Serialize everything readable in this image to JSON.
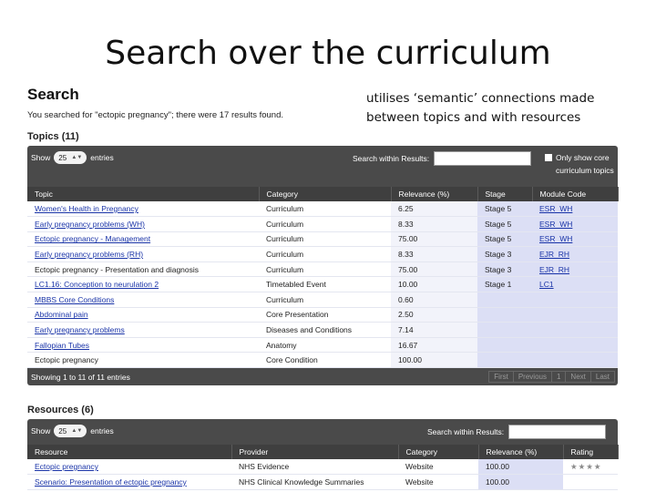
{
  "slide": {
    "title": "Search over the curriculum",
    "caption": "utilises ‘semantic’ connections made between topics and with resources"
  },
  "search": {
    "heading": "Search",
    "summary": "You searched for \"ectopic pregnancy\"; there were 17 results found."
  },
  "topics": {
    "heading": "Topics (11)",
    "show_label": "Show",
    "show_value": "25",
    "entries_label": "entries",
    "search_within_label": "Search within Results:",
    "search_within_value": "",
    "core_only_label": "Only show core curriculum topics",
    "columns": [
      "Topic",
      "Category",
      "Relevance (%)",
      "Stage",
      "Module Code"
    ],
    "rows": [
      {
        "topic": "Women's Health in Pregnancy",
        "category": "Curriculum",
        "relevance": "6.25",
        "stage": "Stage 5",
        "module": "ESR_WH",
        "linked": true
      },
      {
        "topic": "Early pregnancy problems (WH)",
        "category": "Curriculum",
        "relevance": "8.33",
        "stage": "Stage 5",
        "module": "ESR_WH",
        "linked": true
      },
      {
        "topic": "Ectopic pregnancy - Management",
        "category": "Curriculum",
        "relevance": "75.00",
        "stage": "Stage 5",
        "module": "ESR_WH",
        "linked": true
      },
      {
        "topic": "Early pregnancy problems (RH)",
        "category": "Curriculum",
        "relevance": "8.33",
        "stage": "Stage 3",
        "module": "EJR_RH",
        "linked": true
      },
      {
        "topic": "Ectopic pregnancy - Presentation and diagnosis",
        "category": "Curriculum",
        "relevance": "75.00",
        "stage": "Stage 3",
        "module": "EJR_RH",
        "linked": false
      },
      {
        "topic": "LC1.16: Conception to neurulation 2",
        "category": "Timetabled Event",
        "relevance": "10.00",
        "stage": "Stage 1",
        "module": "LC1",
        "linked": true
      },
      {
        "topic": "MBBS Core Conditions",
        "category": "Curriculum",
        "relevance": "0.60",
        "stage": "",
        "module": "",
        "linked": true
      },
      {
        "topic": "Abdominal pain",
        "category": "Core Presentation",
        "relevance": "2.50",
        "stage": "",
        "module": "",
        "linked": true
      },
      {
        "topic": "Early pregnancy problems",
        "category": "Diseases and Conditions",
        "relevance": "7.14",
        "stage": "",
        "module": "",
        "linked": true
      },
      {
        "topic": "Fallopian Tubes",
        "category": "Anatomy",
        "relevance": "16.67",
        "stage": "",
        "module": "",
        "linked": true
      },
      {
        "topic": "Ectopic pregnancy",
        "category": "Core Condition",
        "relevance": "100.00",
        "stage": "",
        "module": "",
        "linked": false
      }
    ],
    "footer_info": "Showing 1 to 11 of 11 entries",
    "pager": [
      "First",
      "Previous",
      "1",
      "Next",
      "Last"
    ]
  },
  "resources": {
    "heading": "Resources (6)",
    "show_label": "Show",
    "show_value": "25",
    "entries_label": "entries",
    "search_within_label": "Search within Results:",
    "search_within_value": "",
    "columns": [
      "Resource",
      "Provider",
      "Category",
      "Relevance (%)",
      "Rating"
    ],
    "rows": [
      {
        "resource": "Ectopic pregnancy",
        "provider": "NHS Evidence",
        "category": "Website",
        "relevance": "100.00",
        "rating": "★★★★"
      },
      {
        "resource": "Scenario: Presentation of ectopic pregnancy",
        "provider": "NHS Clinical Knowledge Summaries",
        "category": "Website",
        "relevance": "100.00",
        "rating": ""
      }
    ]
  },
  "colors": {
    "toolbar": "#4a4a4a",
    "header": "#3f3f3f",
    "link": "#1a34a8",
    "highlight": "#dcdff5"
  }
}
